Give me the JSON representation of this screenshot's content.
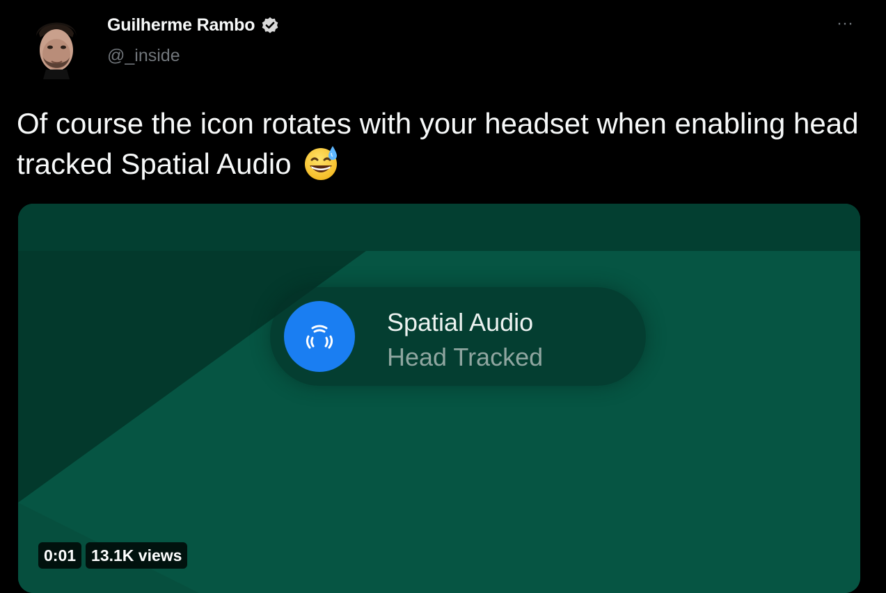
{
  "author": {
    "name": "Guilherme Rambo",
    "handle": "@_inside",
    "avatar_icon": "avatar-photo",
    "verified_icon": "verified-badge-icon"
  },
  "actions": {
    "more_label": "···"
  },
  "tweet": {
    "text": "Of course the icon rotates with your headset when enabling head tracked Spatial Audio",
    "emoji": "grinning-face-with-sweat"
  },
  "media": {
    "notification": {
      "icon": "spatial-audio-icon",
      "title": "Spatial Audio",
      "subtitle": "Head Tracked"
    },
    "timestamp": "0:01",
    "views": "13.1K views"
  },
  "colors": {
    "background": "#000000",
    "video_background": "#064a3b",
    "icon_accent": "#1a7ef2",
    "handle_gray": "#71767b"
  }
}
